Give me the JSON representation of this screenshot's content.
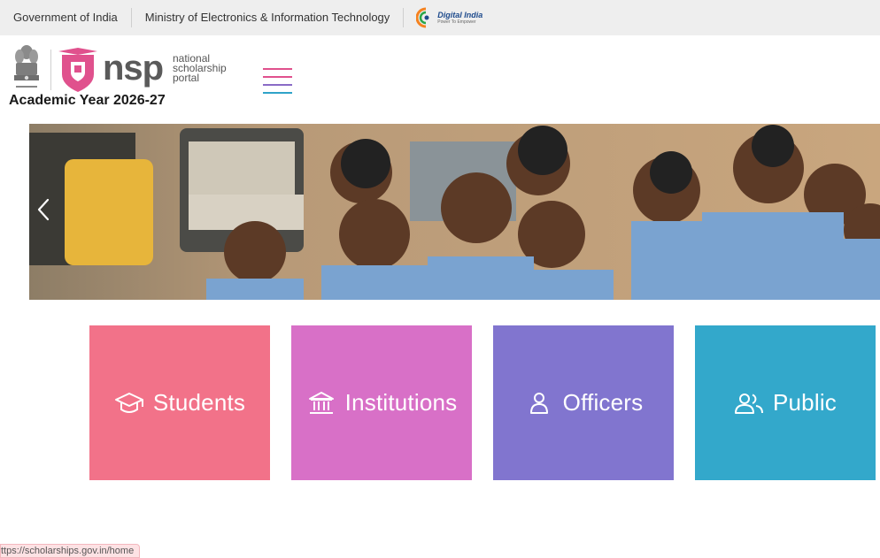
{
  "topbar": {
    "gov_label": "Government of India",
    "ministry_label": "Ministry of Electronics & Information Technology",
    "digital_india": {
      "title": "Digital India",
      "tagline": "Power To Empower"
    }
  },
  "header": {
    "brand": "nsp",
    "brand_sub_1": "national",
    "brand_sub_2": "scholarship",
    "brand_sub_3": "portal",
    "academic_year": "Academic Year 2026-27"
  },
  "banner": {
    "prev_icon": "chevron-left-icon"
  },
  "tiles": [
    {
      "label": "Students",
      "icon": "graduation-cap-icon",
      "color": "#f27289"
    },
    {
      "label": "Institutions",
      "icon": "institution-building-icon",
      "color": "#d870c7"
    },
    {
      "label": "Officers",
      "icon": "user-icon",
      "color": "#8175cf"
    },
    {
      "label": "Public",
      "icon": "users-icon",
      "color": "#33a8cb"
    }
  ],
  "status_url": "ttps://scholarships.gov.in/home",
  "colors": {
    "topbar_bg": "#eeeeee",
    "nsp_pink": "#e0518d",
    "hamburger_pink": "#e0518d",
    "hamburger_purple": "#8a6bc6",
    "hamburger_blue": "#2fa3c8"
  }
}
